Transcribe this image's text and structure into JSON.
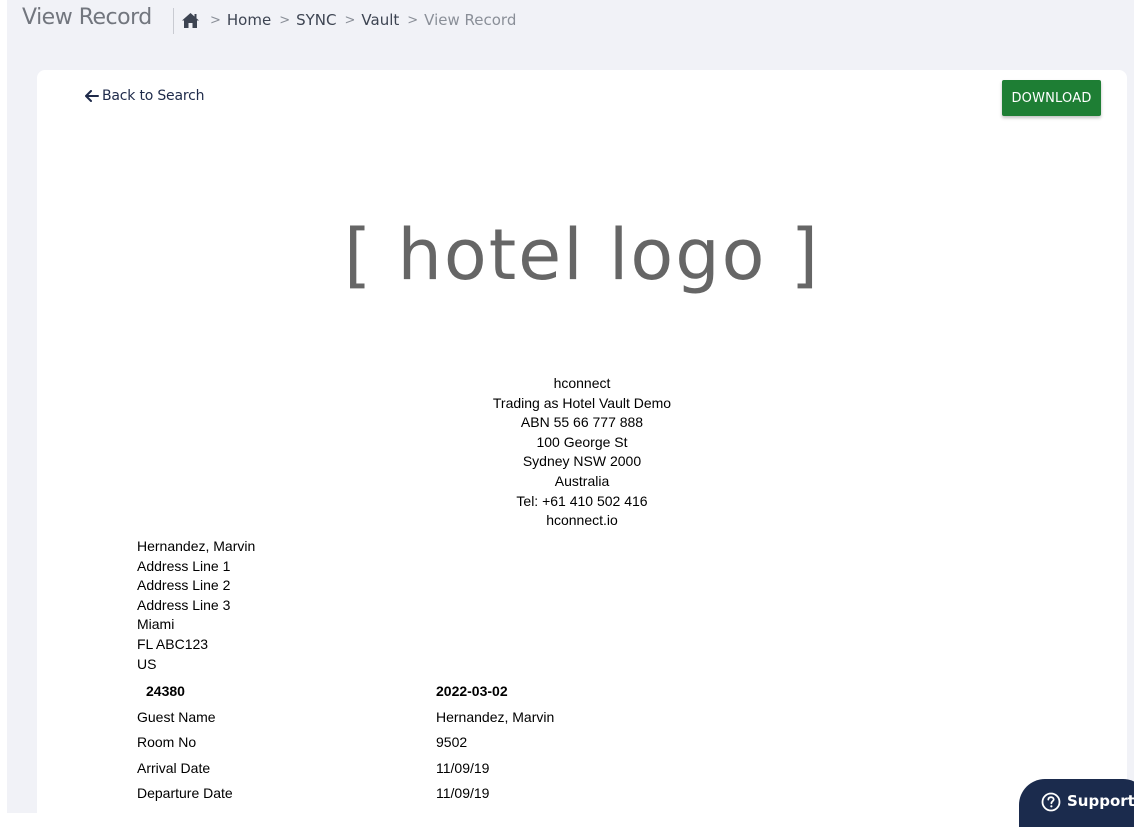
{
  "header": {
    "title": "View Record",
    "home_icon": "home-icon",
    "breadcrumbs": [
      "Home",
      "SYNC",
      "Vault",
      "View Record"
    ],
    "separator": ">"
  },
  "card": {
    "back_label": "Back to Search",
    "back_icon": "arrow-left-icon",
    "download_label": "DOWNLOAD",
    "download_color": "#1e7e34"
  },
  "logo_text": "[ hotel logo ]",
  "hotel_info": [
    "hconnect",
    "Trading as Hotel Vault Demo",
    "ABN 55 66 777 888",
    "100 George St",
    "Sydney NSW 2000",
    "Australia",
    "Tel: +61 410 502 416",
    "hconnect.io"
  ],
  "guest_address": [
    "Hernandez, Marvin",
    "Address Line 1",
    "Address Line 2",
    "Address Line 3",
    "Miami",
    "FL ABC123",
    "US"
  ],
  "record": {
    "number": "24380",
    "date": "2022-03-02",
    "rows": [
      {
        "label": "Guest Name",
        "value": "Hernandez, Marvin"
      },
      {
        "label": "Room No",
        "value": "9502"
      },
      {
        "label": "Arrival Date",
        "value": "11/09/19"
      },
      {
        "label": "Departure Date",
        "value": "11/09/19"
      }
    ]
  },
  "support": {
    "label": "Support",
    "icon": "help-circle-icon"
  }
}
